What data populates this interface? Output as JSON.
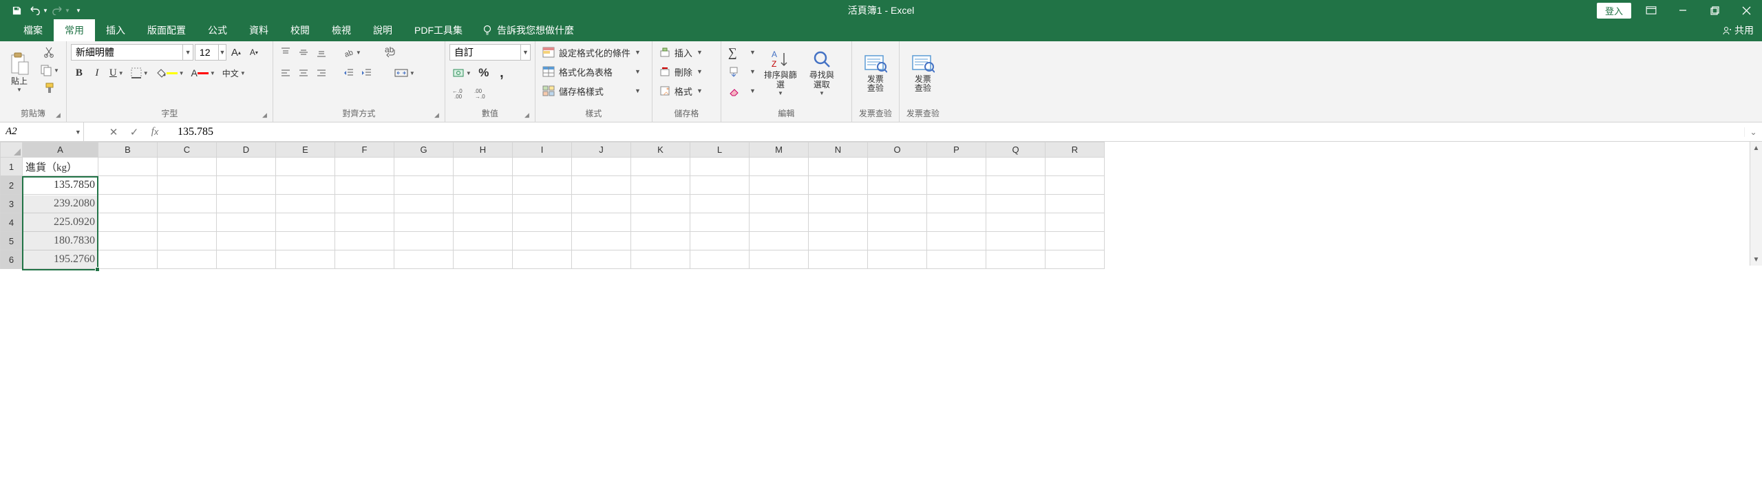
{
  "title": "活頁簿1 - Excel",
  "qat": {
    "save": "save",
    "undo": "undo",
    "redo": "redo"
  },
  "login_label": "登入",
  "share_label": "共用",
  "tabs": [
    "檔案",
    "常用",
    "插入",
    "版面配置",
    "公式",
    "資料",
    "校閱",
    "檢視",
    "說明",
    "PDF工具集"
  ],
  "active_tab": 1,
  "tellme": "告訴我您想做什麼",
  "ribbon": {
    "clipboard": {
      "label": "剪貼簿",
      "paste": "貼上"
    },
    "font": {
      "label": "字型",
      "name": "新細明體",
      "size": "12",
      "phonetic": "中文"
    },
    "align": {
      "label": "對齊方式"
    },
    "number": {
      "label": "數值",
      "format": "自訂"
    },
    "styles": {
      "label": "樣式",
      "cond": "設定格式化的條件",
      "table": "格式化為表格",
      "cell": "儲存格樣式"
    },
    "cells": {
      "label": "儲存格",
      "insert": "插入",
      "delete": "刪除",
      "format": "格式"
    },
    "editing": {
      "label": "編輯",
      "sort": "排序與篩選",
      "find": "尋找與\n選取"
    },
    "fp1": {
      "label": "发票查验",
      "btn": "发票\n查验"
    },
    "fp2": {
      "label": "发票查验",
      "btn": "发票\n查验"
    }
  },
  "namebox": "A2",
  "formula": "135.785",
  "columns": [
    "A",
    "B",
    "C",
    "D",
    "E",
    "F",
    "G",
    "H",
    "I",
    "J",
    "K",
    "L",
    "M",
    "N",
    "O",
    "P",
    "Q",
    "R"
  ],
  "rows": [
    1,
    2,
    3,
    4,
    5,
    6
  ],
  "chart_data": {
    "type": "table",
    "header": "進貨（kg）",
    "values": [
      135.785,
      239.208,
      225.092,
      180.783,
      195.276
    ]
  },
  "cells": {
    "A1": "進貨（kg）",
    "A2": "135.7850",
    "A3": "239.2080",
    "A4": "225.0920",
    "A5": "180.7830",
    "A6": "195.2760"
  },
  "selection": {
    "col": "A",
    "rows": [
      2,
      6
    ]
  }
}
